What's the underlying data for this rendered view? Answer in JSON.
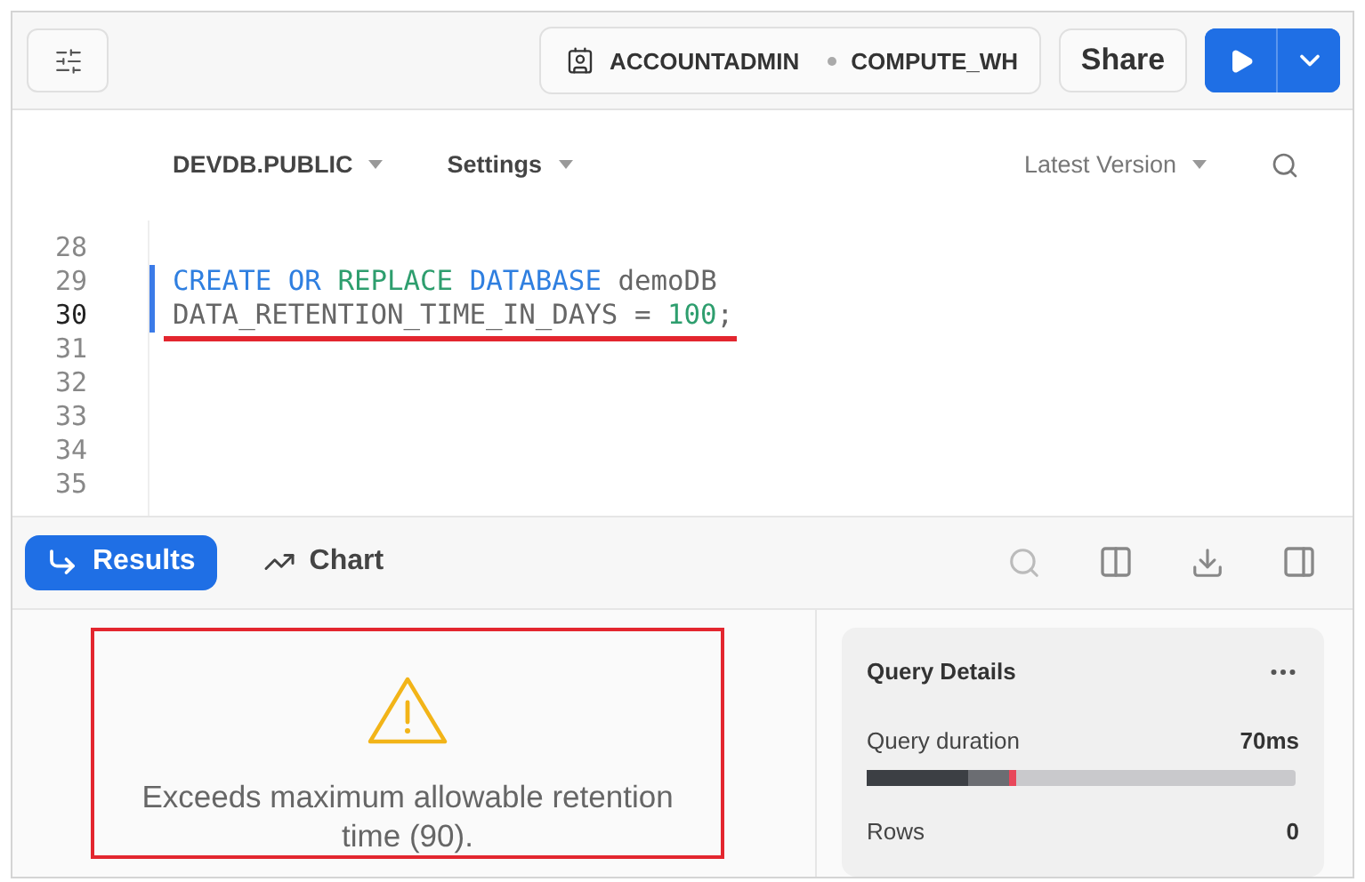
{
  "top_bar": {
    "role": "ACCOUNTADMIN",
    "warehouse": "COMPUTE_WH",
    "share_button": "Share"
  },
  "editor_toolbar": {
    "items": [
      {
        "label": "DEVDB.PUBLIC"
      },
      {
        "label": "Settings"
      }
    ],
    "version": "Latest Version"
  },
  "code_lines": [
    {
      "number": "28",
      "modified": false,
      "current": false
    },
    {
      "number": "29",
      "modified": true,
      "current": false,
      "tokens": [
        {
          "kind": "keyword",
          "text": "CREATE"
        },
        {
          "kind": "keyword",
          "text": " OR "
        },
        {
          "kind": "function",
          "text": "REPLACE"
        },
        {
          "kind": "keyword",
          "text": " DATABASE"
        },
        {
          "kind": "plain",
          "text": " demoDB"
        }
      ]
    },
    {
      "number": "30",
      "modified": true,
      "current": true,
      "tokens": [
        {
          "kind": "plain",
          "text": "DATA_RETENTION_TIME_IN_DAYS = "
        },
        {
          "kind": "number",
          "text": "100"
        },
        {
          "kind": "plain",
          "text": ";"
        }
      ]
    },
    {
      "number": "31",
      "modified": false,
      "current": false
    },
    {
      "number": "32",
      "modified": false,
      "current": false
    },
    {
      "number": "33",
      "modified": false,
      "current": false
    },
    {
      "number": "34",
      "modified": false,
      "current": false
    },
    {
      "number": "35",
      "modified": false,
      "current": false
    }
  ],
  "results_tabs": [
    {
      "label": "Results",
      "selected": true
    },
    {
      "label": "Chart",
      "selected": false
    }
  ],
  "error_message": "Exceeds maximum allowable retention time (90).",
  "query_details": {
    "title": "Query Details",
    "rows": [
      {
        "label": "Query duration",
        "value": "70ms"
      },
      {
        "label": "Rows",
        "value": "0"
      }
    ]
  }
}
